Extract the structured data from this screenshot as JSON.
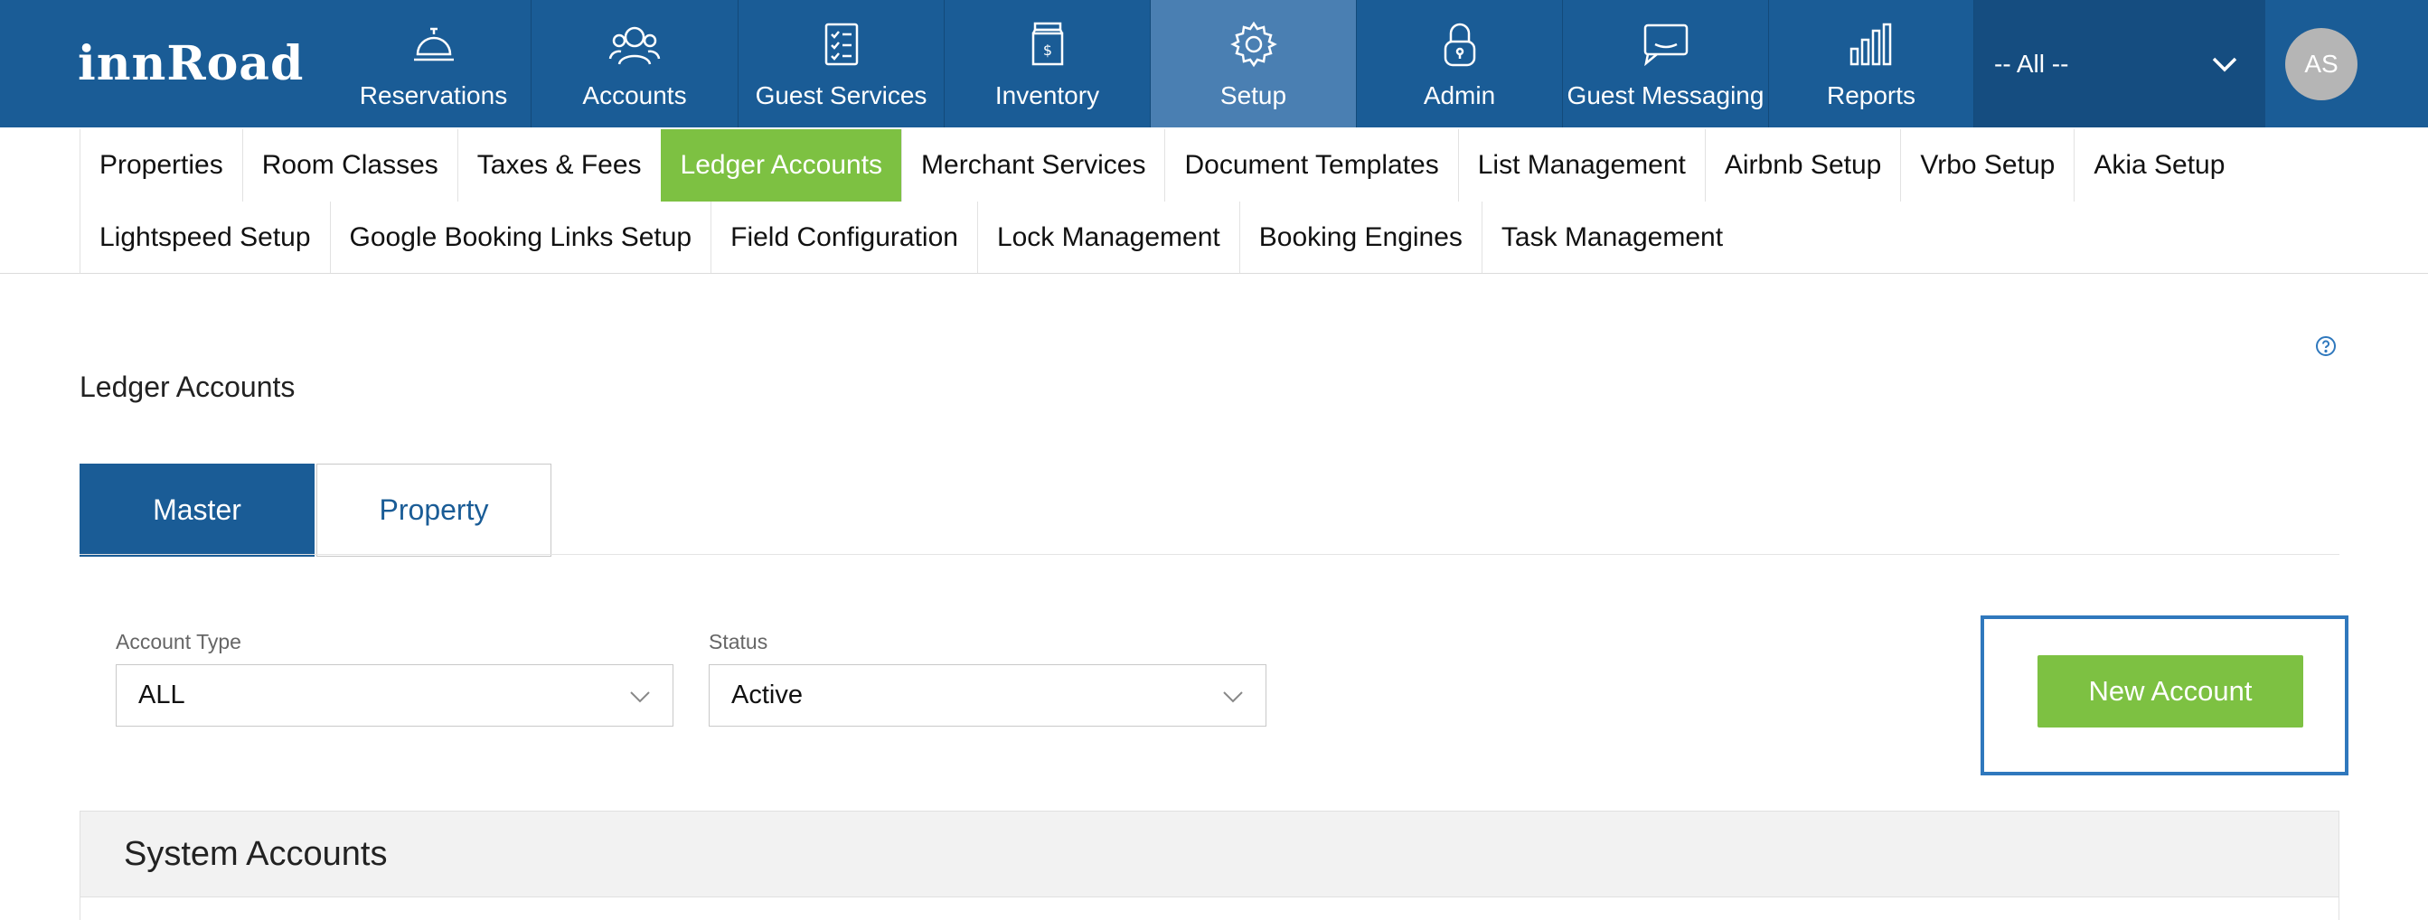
{
  "brand": {
    "logo_text": "innRoad"
  },
  "topnav": {
    "items": [
      {
        "label": "Reservations",
        "icon": "bell-icon"
      },
      {
        "label": "Accounts",
        "icon": "users-icon"
      },
      {
        "label": "Guest Services",
        "icon": "checklist-icon"
      },
      {
        "label": "Inventory",
        "icon": "jar-icon"
      },
      {
        "label": "Setup",
        "icon": "gear-icon",
        "active": true
      },
      {
        "label": "Admin",
        "icon": "lock-icon"
      },
      {
        "label": "Guest Messaging",
        "icon": "chat-icon"
      },
      {
        "label": "Reports",
        "icon": "bar-chart-icon"
      }
    ],
    "property_selector": {
      "value": "-- All --"
    },
    "avatar": {
      "initials": "AS"
    }
  },
  "subnav": {
    "row1": [
      "Properties",
      "Room Classes",
      "Taxes & Fees",
      "Ledger Accounts",
      "Merchant Services",
      "Document Templates",
      "List Management",
      "Airbnb Setup",
      "Vrbo Setup",
      "Akia Setup"
    ],
    "row2": [
      "Lightspeed Setup",
      "Google Booking Links Setup",
      "Field Configuration",
      "Lock Management",
      "Booking Engines",
      "Task Management"
    ],
    "active": "Ledger Accounts"
  },
  "page": {
    "title": "Ledger Accounts"
  },
  "tabs": {
    "master": "Master",
    "property": "Property",
    "active": "Master"
  },
  "filters": {
    "account_type": {
      "label": "Account Type",
      "value": "ALL"
    },
    "status": {
      "label": "Status",
      "value": "Active"
    }
  },
  "actions": {
    "new_account": "New Account"
  },
  "section": {
    "title": "System Accounts"
  },
  "colors": {
    "nav_bg": "#1a5c96",
    "nav_active": "#4a7fb2",
    "accent_green": "#7dc142",
    "highlight_blue": "#2f78bd"
  }
}
